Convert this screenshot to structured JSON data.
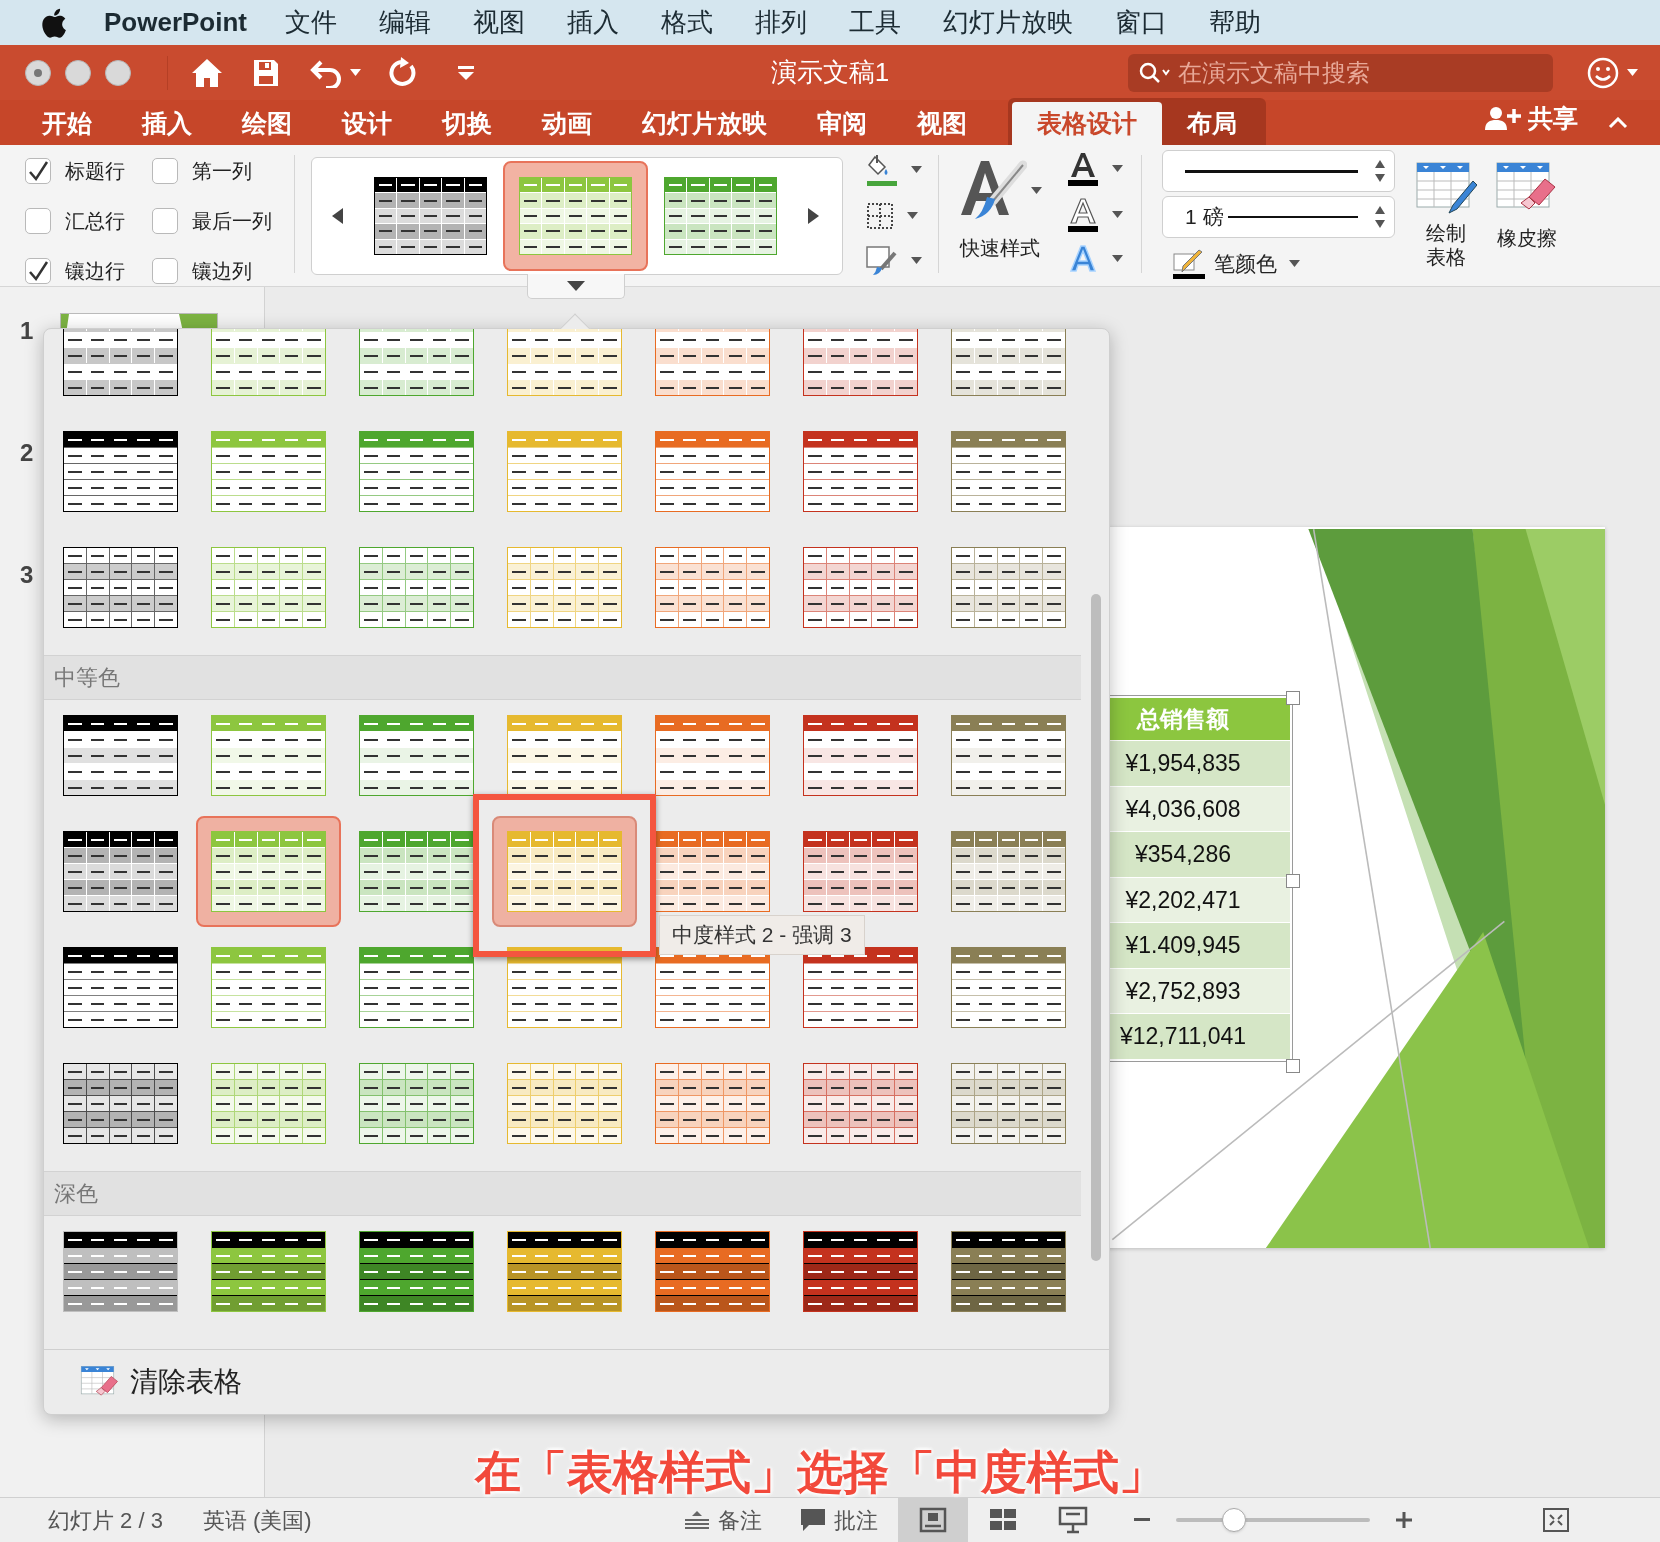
{
  "menu_bar": {
    "app": "PowerPoint",
    "items": [
      "文件",
      "编辑",
      "视图",
      "插入",
      "格式",
      "排列",
      "工具",
      "幻灯片放映",
      "窗口",
      "帮助"
    ]
  },
  "window": {
    "title": "演示文稿1",
    "search": {
      "placeholder": "在演示文稿中搜索"
    }
  },
  "tabs": [
    {
      "label": "开始",
      "selected": false,
      "contextual": false
    },
    {
      "label": "插入",
      "selected": false,
      "contextual": false
    },
    {
      "label": "绘图",
      "selected": false,
      "contextual": false
    },
    {
      "label": "设计",
      "selected": false,
      "contextual": false
    },
    {
      "label": "切换",
      "selected": false,
      "contextual": false
    },
    {
      "label": "动画",
      "selected": false,
      "contextual": false
    },
    {
      "label": "幻灯片放映",
      "selected": false,
      "contextual": false
    },
    {
      "label": "审阅",
      "selected": false,
      "contextual": false
    },
    {
      "label": "视图",
      "selected": false,
      "contextual": false
    },
    {
      "label": "表格设计",
      "selected": true,
      "contextual": true
    },
    {
      "label": "布局",
      "selected": false,
      "contextual": true
    }
  ],
  "share": "共享",
  "ribbon": {
    "options": [
      {
        "label": "标题行",
        "checked": true
      },
      {
        "label": "第一列",
        "checked": false
      },
      {
        "label": "汇总行",
        "checked": false
      },
      {
        "label": "最后一列",
        "checked": false
      },
      {
        "label": "镶边行",
        "checked": true
      },
      {
        "label": "镶边列",
        "checked": false
      }
    ],
    "style_gallery": {
      "kind": "medium-banded",
      "swatches": [
        {
          "color": "#000000",
          "selected": false
        },
        {
          "color": "#8dc63f",
          "selected": true
        },
        {
          "color": "#4ea72e",
          "selected": false
        }
      ]
    },
    "quick_styles": "快速样式",
    "pen_weight": "1 磅",
    "pen_color": "笔颜色",
    "draw_table": "绘制表格",
    "eraser": "橡皮擦"
  },
  "slides_pane": {
    "numbers": [
      "1",
      "2",
      "3"
    ]
  },
  "style_gallery_popup": {
    "sections": [
      {
        "rows": [
          {
            "kind": "light-banded",
            "swatches": [
              {
                "color": "#000000",
                "selected": false,
                "hovered": false
              },
              {
                "color": "#8dc63f",
                "selected": false,
                "hovered": false
              },
              {
                "color": "#4ea72e",
                "selected": false,
                "hovered": false
              },
              {
                "color": "#e6b92f",
                "selected": false,
                "hovered": false
              },
              {
                "color": "#e86b22",
                "selected": false,
                "hovered": false
              },
              {
                "color": "#c4321e",
                "selected": false,
                "hovered": false
              },
              {
                "color": "#8a7f55",
                "selected": false,
                "hovered": false
              }
            ]
          },
          {
            "kind": "light-header",
            "swatches": [
              {
                "color": "#000000",
                "selected": false,
                "hovered": false
              },
              {
                "color": "#8dc63f",
                "selected": false,
                "hovered": false
              },
              {
                "color": "#4ea72e",
                "selected": false,
                "hovered": false
              },
              {
                "color": "#e6b92f",
                "selected": false,
                "hovered": false
              },
              {
                "color": "#e86b22",
                "selected": false,
                "hovered": false
              },
              {
                "color": "#c4321e",
                "selected": false,
                "hovered": false
              },
              {
                "color": "#8a7f55",
                "selected": false,
                "hovered": false
              }
            ]
          },
          {
            "kind": "light-grid",
            "swatches": [
              {
                "color": "#000000",
                "selected": false,
                "hovered": false
              },
              {
                "color": "#8dc63f",
                "selected": false,
                "hovered": false
              },
              {
                "color": "#4ea72e",
                "selected": false,
                "hovered": false
              },
              {
                "color": "#e6b92f",
                "selected": false,
                "hovered": false
              },
              {
                "color": "#e86b22",
                "selected": false,
                "hovered": false
              },
              {
                "color": "#c4321e",
                "selected": false,
                "hovered": false
              },
              {
                "color": "#8a7f55",
                "selected": false,
                "hovered": false
              }
            ]
          }
        ]
      },
      {
        "heading": "中等色",
        "rows": [
          {
            "kind": "medium-header",
            "swatches": [
              {
                "color": "#000000",
                "selected": false,
                "hovered": false
              },
              {
                "color": "#8dc63f",
                "selected": false,
                "hovered": false
              },
              {
                "color": "#4ea72e",
                "selected": false,
                "hovered": false
              },
              {
                "color": "#e6b92f",
                "selected": false,
                "hovered": false
              },
              {
                "color": "#e86b22",
                "selected": false,
                "hovered": false
              },
              {
                "color": "#c4321e",
                "selected": false,
                "hovered": false
              },
              {
                "color": "#8a7f55",
                "selected": false,
                "hovered": false
              }
            ]
          },
          {
            "kind": "medium-banded",
            "swatches": [
              {
                "color": "#000000",
                "selected": false,
                "hovered": false
              },
              {
                "color": "#8dc63f",
                "selected": true,
                "hovered": false
              },
              {
                "color": "#4ea72e",
                "selected": false,
                "hovered": false
              },
              {
                "color": "#e6b92f",
                "selected": false,
                "hovered": true
              },
              {
                "color": "#e86b22",
                "selected": false,
                "hovered": false
              },
              {
                "color": "#c4321e",
                "selected": false,
                "hovered": false
              },
              {
                "color": "#8a7f55",
                "selected": false,
                "hovered": false
              }
            ]
          },
          {
            "kind": "medium-plain",
            "swatches": [
              {
                "color": "#000000",
                "selected": false,
                "hovered": false
              },
              {
                "color": "#8dc63f",
                "selected": false,
                "hovered": false
              },
              {
                "color": "#4ea72e",
                "selected": false,
                "hovered": false
              },
              {
                "color": "#e6b92f",
                "selected": false,
                "hovered": false
              },
              {
                "color": "#e86b22",
                "selected": false,
                "hovered": false
              },
              {
                "color": "#c4321e",
                "selected": false,
                "hovered": false
              },
              {
                "color": "#8a7f55",
                "selected": false,
                "hovered": false
              }
            ]
          },
          {
            "kind": "medium-grid",
            "swatches": [
              {
                "color": "#000000",
                "selected": false,
                "hovered": false
              },
              {
                "color": "#8dc63f",
                "selected": false,
                "hovered": false
              },
              {
                "color": "#4ea72e",
                "selected": false,
                "hovered": false
              },
              {
                "color": "#e6b92f",
                "selected": false,
                "hovered": false
              },
              {
                "color": "#e86b22",
                "selected": false,
                "hovered": false
              },
              {
                "color": "#c4321e",
                "selected": false,
                "hovered": false
              },
              {
                "color": "#8a7f55",
                "selected": false,
                "hovered": false
              }
            ]
          }
        ]
      },
      {
        "heading": "深色",
        "rows": [
          {
            "kind": "dark",
            "swatches": [
              {
                "color": "#bfbfbf",
                "selected": false,
                "hovered": false
              },
              {
                "color": "#8dc63f",
                "selected": false,
                "hovered": false
              },
              {
                "color": "#4ea72e",
                "selected": false,
                "hovered": false
              },
              {
                "color": "#e6b92f",
                "selected": false,
                "hovered": false
              },
              {
                "color": "#e86b22",
                "selected": false,
                "hovered": false
              },
              {
                "color": "#c4321e",
                "selected": false,
                "hovered": false
              },
              {
                "color": "#8a7f55",
                "selected": false,
                "hovered": false
              }
            ]
          }
        ]
      }
    ],
    "tooltip": "中度样式 2 - 强调 3",
    "clear_table": "清除表格"
  },
  "slide": {
    "table": {
      "header": "总销售额",
      "rows": [
        "¥1,954,835",
        "¥4,036,608",
        "¥354,286",
        "¥2,202,471",
        "¥1.409,945",
        "¥2,752,893",
        "¥12,711,041"
      ]
    }
  },
  "caption": "在「表格样式」选择「中度样式」",
  "status_bar": {
    "slide": "幻灯片 2 / 3",
    "language": "英语 (美国)",
    "notes": "备注",
    "comments": "批注",
    "views": [
      {
        "kind": "normal",
        "selected": true
      },
      {
        "kind": "sorter",
        "selected": false
      },
      {
        "kind": "presenter",
        "selected": false
      }
    ],
    "zoom": {
      "level": 0.3
    }
  }
}
